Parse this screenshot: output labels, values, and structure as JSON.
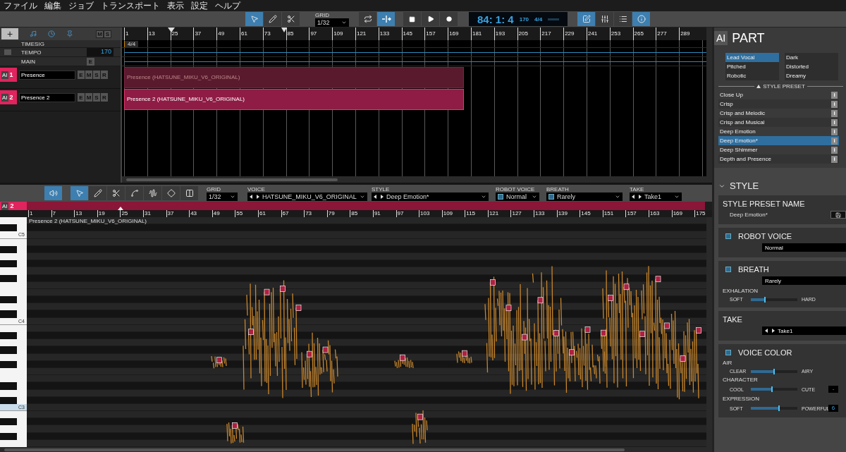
{
  "menu": [
    "ファイル",
    "編集",
    "ジョブ",
    "トランスポート",
    "表示",
    "設定",
    "ヘルプ"
  ],
  "toolbar": {
    "tools": [
      {
        "kind": "select",
        "selected": true
      },
      {
        "kind": "pencil",
        "selected": false
      },
      {
        "kind": "scissors",
        "selected": false
      }
    ],
    "grid": {
      "label": "GRID",
      "value": "1/32"
    },
    "toggles": [
      {
        "kind": "loop",
        "selected": false
      },
      {
        "kind": "autoscroll",
        "selected": true
      }
    ],
    "transport": [
      {
        "kind": "stop"
      },
      {
        "kind": "play"
      },
      {
        "kind": "record"
      }
    ],
    "display": {
      "position": "84: 1: 4",
      "tempo": "170",
      "timesig": "4/4"
    },
    "views": [
      {
        "kind": "edit",
        "selected": true
      },
      {
        "kind": "mixer",
        "selected": false
      },
      {
        "kind": "list",
        "selected": false
      },
      {
        "kind": "info",
        "selected": true
      }
    ]
  },
  "track_panel": {
    "add": "+",
    "buttons": [
      "M",
      "S"
    ],
    "rows": [
      {
        "label": "TIMESIG"
      },
      {
        "label": "TEMPO",
        "value": "170",
        "checked": false
      },
      {
        "label": "MAIN",
        "button": "E"
      }
    ],
    "tracks": [
      {
        "badge": "AI",
        "number": "1",
        "name": "Presence",
        "buttons": [
          "E",
          "M",
          "S",
          "R"
        ]
      },
      {
        "badge": "AI",
        "number": "2",
        "name": "Presence 2",
        "buttons": [
          "E",
          "M",
          "S",
          "R"
        ]
      }
    ]
  },
  "arrangement": {
    "ruler": [
      "1",
      "13",
      "25",
      "37",
      "49",
      "61",
      "73",
      "85",
      "97",
      "109",
      "121",
      "133",
      "145",
      "157",
      "169",
      "181",
      "193",
      "205",
      "217",
      "229",
      "241",
      "253",
      "265",
      "277",
      "289"
    ],
    "timesig": "4/4",
    "parts": [
      {
        "label": "Presence (HATSUNE_MIKU_V6_ORIGINAL)",
        "selected": false
      },
      {
        "label": "Presence 2 (HATSUNE_MIKU_V6_ORIGINAL)",
        "selected": true
      }
    ]
  },
  "editor": {
    "toolbar": {
      "speaker": {
        "selected": true
      },
      "tools": [
        {
          "kind": "select",
          "selected": true
        },
        {
          "kind": "pencil",
          "selected": false
        },
        {
          "kind": "scissors",
          "selected": false
        },
        {
          "kind": "pitch",
          "selected": false
        },
        {
          "kind": "vibrato",
          "selected": false
        },
        {
          "kind": "warp",
          "selected": false
        },
        {
          "kind": "split",
          "selected": false
        }
      ],
      "fields": [
        {
          "kind": "select",
          "label": "GRID",
          "value": "1/32"
        },
        {
          "kind": "arrows",
          "label": "VOICE",
          "value": "HATSUNE_MIKU_V6_ORIGINAL"
        },
        {
          "kind": "arrows",
          "label": "STYLE",
          "value": "Deep Emotion*"
        },
        {
          "kind": "check",
          "label": "ROBOT VOICE",
          "value": "Normal",
          "checked": true
        },
        {
          "kind": "check",
          "label": "BREATH",
          "value": "Rarely",
          "checked": true
        },
        {
          "kind": "arrows",
          "label": "TAKE",
          "value": "Take1"
        }
      ]
    },
    "badge": "AI",
    "track_number": "2",
    "ruler": [
      "1",
      "7",
      "13",
      "19",
      "25",
      "31",
      "37",
      "43",
      "49",
      "55",
      "61",
      "67",
      "73",
      "79",
      "85",
      "91",
      "97",
      "103",
      "109",
      "115",
      "121",
      "127",
      "133",
      "139",
      "145",
      "151",
      "157",
      "163",
      "169",
      "175"
    ],
    "part_label": "Presence 2 (HATSUNE_MIKU_V6_ORIGINAL)",
    "key_labels": [
      {
        "label": "C5",
        "highlighted": false
      },
      {
        "label": "C4",
        "highlighted": false
      },
      {
        "label": "C3",
        "highlighted": true
      }
    ]
  },
  "panel": {
    "badge": "AI",
    "title": "PART",
    "voice_type_columns": [
      {
        "items": [
          {
            "label": "Lead Vocal",
            "selected": true
          },
          {
            "label": "Pitched",
            "selected": false
          },
          {
            "label": "Robotic",
            "selected": false
          }
        ]
      },
      {
        "items": [
          {
            "label": "Dark",
            "selected": false
          },
          {
            "label": "Distorted",
            "selected": false
          },
          {
            "label": "Dreamy",
            "selected": false
          }
        ]
      }
    ],
    "preset_heading": "STYLE PRESET",
    "presets": [
      {
        "label": "Close Up",
        "info": "i",
        "selected": false
      },
      {
        "label": "Crisp",
        "info": "i",
        "selected": false
      },
      {
        "label": "Crisp and Melodic",
        "info": "i",
        "selected": false
      },
      {
        "label": "Crisp and Musical",
        "info": "i",
        "selected": false
      },
      {
        "label": "Deep Emotion",
        "info": "i",
        "selected": false
      },
      {
        "label": "Deep Emotion*",
        "info": "i",
        "selected": true
      },
      {
        "label": "Deep Shimmer",
        "info": "i",
        "selected": false
      },
      {
        "label": "Depth and Presence",
        "info": "i",
        "selected": false
      }
    ],
    "style": {
      "title": "STYLE",
      "expanded": true,
      "preset_name_label": "STYLE PRESET NAME",
      "preset_name": "Deep Emotion*"
    },
    "sections": [
      {
        "kind": "toggle",
        "title": "ROBOT VOICE",
        "checked": true,
        "value": "Normal"
      },
      {
        "kind": "toggle",
        "title": "BREATH",
        "checked": true,
        "value": "Rarely",
        "sliders": [
          {
            "label": "EXHALATION",
            "min": "SOFT",
            "max": "HARD",
            "level": 0.3
          }
        ]
      },
      {
        "kind": "plain",
        "title": "TAKE",
        "value": "Take1",
        "stepper": true
      },
      {
        "kind": "toggle",
        "title": "VOICE COLOR",
        "checked": true,
        "sliders": [
          {
            "label": "AIR",
            "min": "CLEAR",
            "max": "AIRY",
            "level": 0.5
          },
          {
            "label": "CHARACTER",
            "min": "COOL",
            "max": "CUTE",
            "level": 0.45,
            "reading": "-"
          },
          {
            "label": "EXPRESSION",
            "min": "SOFT",
            "max": "POWERFUL",
            "level": 0.6,
            "reading": "6"
          }
        ]
      }
    ]
  }
}
